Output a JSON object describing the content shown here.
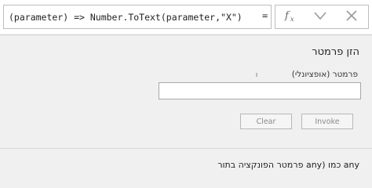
{
  "formula_bar": {
    "equals": "=",
    "text": "parameter)",
    "text_full": "(parameter) => Number.ToText(parameter,\"X\")",
    "icons": [
      "close-icon",
      "checkmark-icon",
      "fx-icon"
    ]
  },
  "dialog": {
    "title": "הזן פרמטר",
    "field_label": "פרמטר (אופציונלי)",
    "input_value": "",
    "invoke_label": "Invoke",
    "clear_label": "Clear"
  },
  "footer": {
    "text": "פרמטר הפונקציה בתור any) כמו any"
  }
}
